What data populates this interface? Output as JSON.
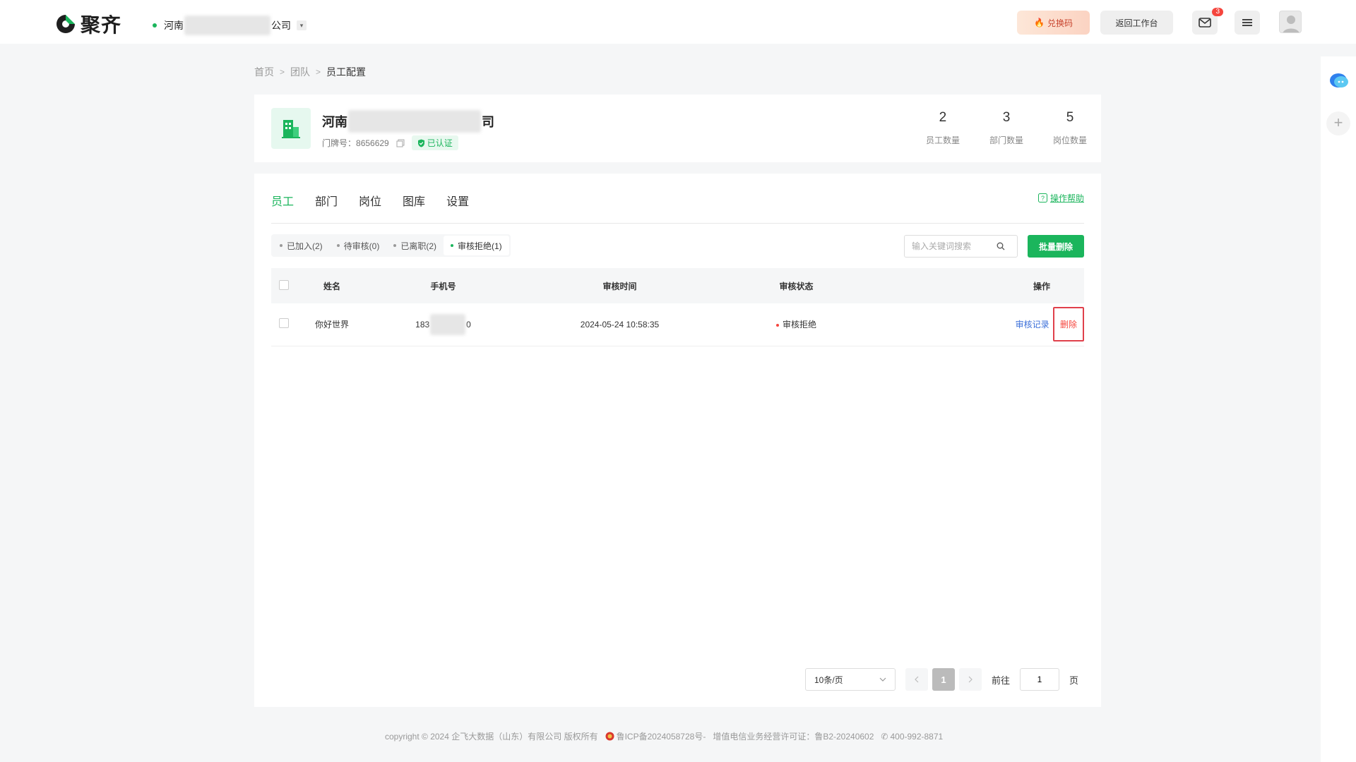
{
  "header": {
    "logo_text": "聚齐",
    "org_name_prefix": "河南",
    "org_name_suffix": "公司",
    "redeem_label": "兑换码",
    "back_label": "返回工作台",
    "mail_badge": "3"
  },
  "breadcrumb": [
    "首页",
    "团队",
    "员工配置"
  ],
  "company": {
    "name_prefix": "河南",
    "name_suffix": "司",
    "doorplate_label": "门牌号：",
    "doorplate_value": "8656629",
    "verified_label": "已认证",
    "stats": [
      {
        "value": "2",
        "label": "员工数量"
      },
      {
        "value": "3",
        "label": "部门数量"
      },
      {
        "value": "5",
        "label": "岗位数量"
      }
    ]
  },
  "tabs": [
    "员工",
    "部门",
    "岗位",
    "图库",
    "设置"
  ],
  "help_label": "操作帮助",
  "filters": [
    "已加入(2)",
    "待审核(0)",
    "已离职(2)",
    "审核拒绝(1)"
  ],
  "search": {
    "placeholder": "输入关键词搜索"
  },
  "batch_delete_label": "批量删除",
  "table": {
    "columns": [
      "姓名",
      "手机号",
      "审核时间",
      "审核状态",
      "操作"
    ],
    "rows": [
      {
        "name": "你好世界",
        "phone_prefix": "183",
        "phone_suffix": "0",
        "time": "2024-05-24 10:58:35",
        "status": "审核拒绝",
        "action_record": "审核记录",
        "action_delete": "删除"
      }
    ]
  },
  "pagination": {
    "page_size": "10条/页",
    "current_page": "1",
    "goto_label": "前往",
    "goto_value": "1",
    "page_suffix": "页"
  },
  "footer": {
    "copyright": "copyright © 2024 企飞大数据（山东）有限公司 版权所有",
    "icp": "鲁ICP备2024058728号-",
    "license": "增值电信业务经营许可证：鲁B2-20240602",
    "phone": "400-992-8871"
  },
  "colors": {
    "brand": "#1bb55c",
    "danger": "#f5453d",
    "link": "#3b6fd9"
  }
}
